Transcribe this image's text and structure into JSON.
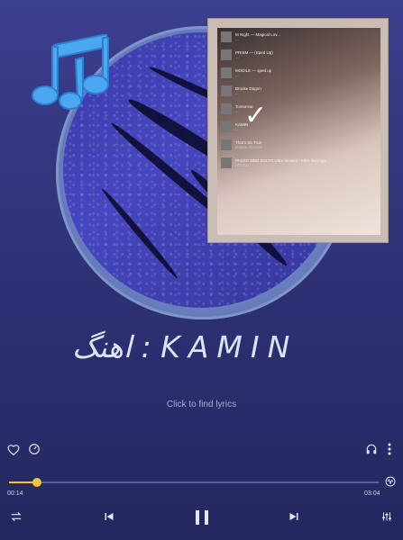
{
  "title": "اهنگ  :  KAMIN",
  "lyrics_prompt": "Click to find lyrics",
  "progress": {
    "elapsed": "00:14",
    "duration": "03:04",
    "fraction": 0.076
  },
  "accent_color": "#f5c23a",
  "screenshot": {
    "rows": [
      {
        "title": "M Night — Magical Lov...",
        "sub": "..."
      },
      {
        "title": "PRISM — (Sped Up)",
        "sub": "..."
      },
      {
        "title": "MODILE — sped up",
        "sub": "..."
      },
      {
        "title": "Brooke Dagon",
        "sub": "..."
      },
      {
        "title": "Tomorrow",
        "sub": "..."
      },
      {
        "title": "KAMIN",
        "sub": "..."
      },
      {
        "title": "That's So True",
        "sub": "Gracie Abrams"
      },
      {
        "title": "PASSO BEM SOLTO Ultra Slowed - Atlxs Mashup",
        "sub": "ATLXS"
      }
    ]
  },
  "icons": {
    "favorite": "heart-icon",
    "speed": "speed-gauge-icon",
    "headphones": "headphones-icon",
    "more": "more-vertical-icon",
    "waveform": "waveform-icon",
    "repeat": "repeat-icon",
    "previous": "skip-previous-icon",
    "pause": "pause-icon",
    "next": "skip-next-icon",
    "equalizer": "equalizer-icon"
  }
}
